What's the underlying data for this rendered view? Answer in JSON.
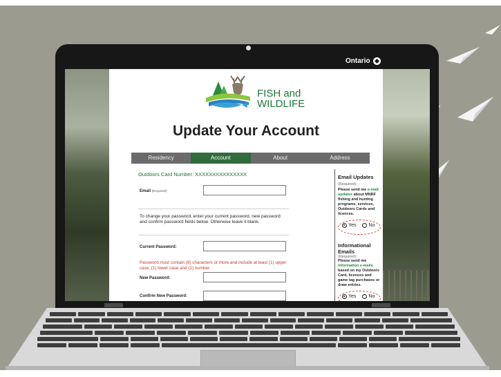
{
  "device": {
    "brand_label": "Ontario"
  },
  "site": {
    "logo_line1": "FISH and",
    "logo_line2": "WILDLIFE",
    "page_title": "Update Your Account"
  },
  "tabs": [
    {
      "label": "Residency",
      "active": false
    },
    {
      "label": "Account",
      "active": true
    },
    {
      "label": "About",
      "active": false
    },
    {
      "label": "Address",
      "active": false
    }
  ],
  "form": {
    "card_number_label": "Outdoors Card Number:",
    "card_number_value": "XXXXXXXXXXXXXXX",
    "email_label": "Email",
    "email_required": "(Required):",
    "email_value": "",
    "password_help": "To change your password, enter your current password, new password and confirm password fields below. Otherwise leave it blank.",
    "current_password_label": "Current Password:",
    "password_rule": "Password must contain (8) characters or more and include at least (1) upper case, (1) lower case and (1) number.",
    "new_password_label": "New Password:",
    "confirm_password_label": "Confirm New Password:"
  },
  "email_updates": {
    "title": "Email Updates",
    "required": "(Required):",
    "text_before": "Please send me ",
    "text_link": "e-mail updates",
    "text_after": " about MNRF fishing and hunting programs, services, Outdoors Cards and licences.",
    "yes_label": "Yes",
    "no_label": "No",
    "selected": "Yes"
  },
  "informational_emails": {
    "title": "Informational Emails",
    "required": "(Required):",
    "text_before": "Please send me ",
    "text_link": "information e-mails",
    "text_after": " based on my Outdoors Card, licences and game tag purchases or draw entries.",
    "yes_label": "Yes",
    "no_label": "No",
    "selected": "Yes"
  },
  "colors": {
    "brand_green": "#2f6b3b",
    "tab_gray": "#6b6b6b",
    "warning_red": "#c0392b",
    "laptop_bezel": "#171717"
  }
}
